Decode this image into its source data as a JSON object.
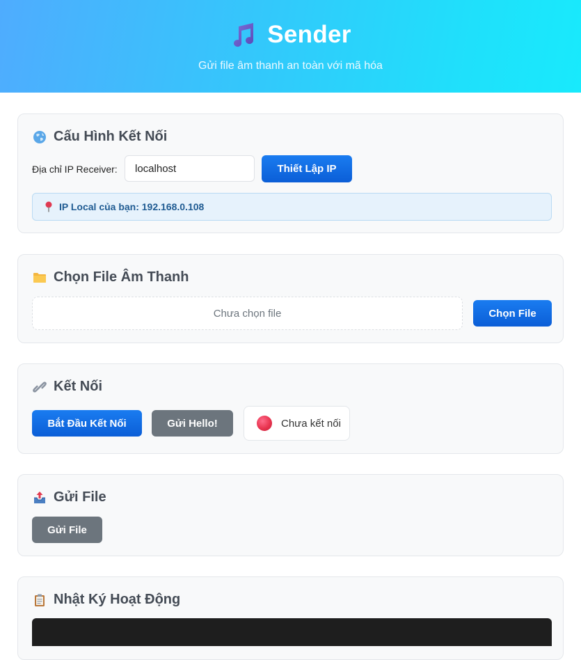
{
  "header": {
    "title": "Sender",
    "subtitle": "Gửi file âm thanh an toàn với mã hóa",
    "icon": "music-note-icon"
  },
  "connection_config": {
    "title": "Cấu Hình Kết Nối",
    "icon": "globe-icon",
    "ip_label": "Địa chỉ IP Receiver:",
    "ip_value": "localhost",
    "set_ip_button": "Thiết Lập IP",
    "local_ip_icon": "pin-icon",
    "local_ip_text": "IP Local của bạn: 192.168.0.108"
  },
  "file_select": {
    "title": "Chọn File Âm Thanh",
    "icon": "folder-icon",
    "file_status": "Chưa chọn file",
    "choose_button": "Chọn File"
  },
  "connect": {
    "title": "Kết Nối",
    "icon": "link-icon",
    "start_button": "Bắt Đầu Kết Nối",
    "hello_button": "Gửi Hello!",
    "status_text": "Chưa kết nối",
    "status_color": "#e8344f"
  },
  "send_file": {
    "title": "Gửi File",
    "icon": "outbox-tray-icon",
    "send_button": "Gửi File"
  },
  "activity_log": {
    "title": "Nhật Ký Hoạt Động",
    "icon": "clipboard-icon"
  },
  "colors": {
    "primary": "#0b5ed7",
    "gray_button": "#6c757d",
    "header_gradient_start": "#4facfe",
    "header_gradient_end": "#18eafc"
  }
}
